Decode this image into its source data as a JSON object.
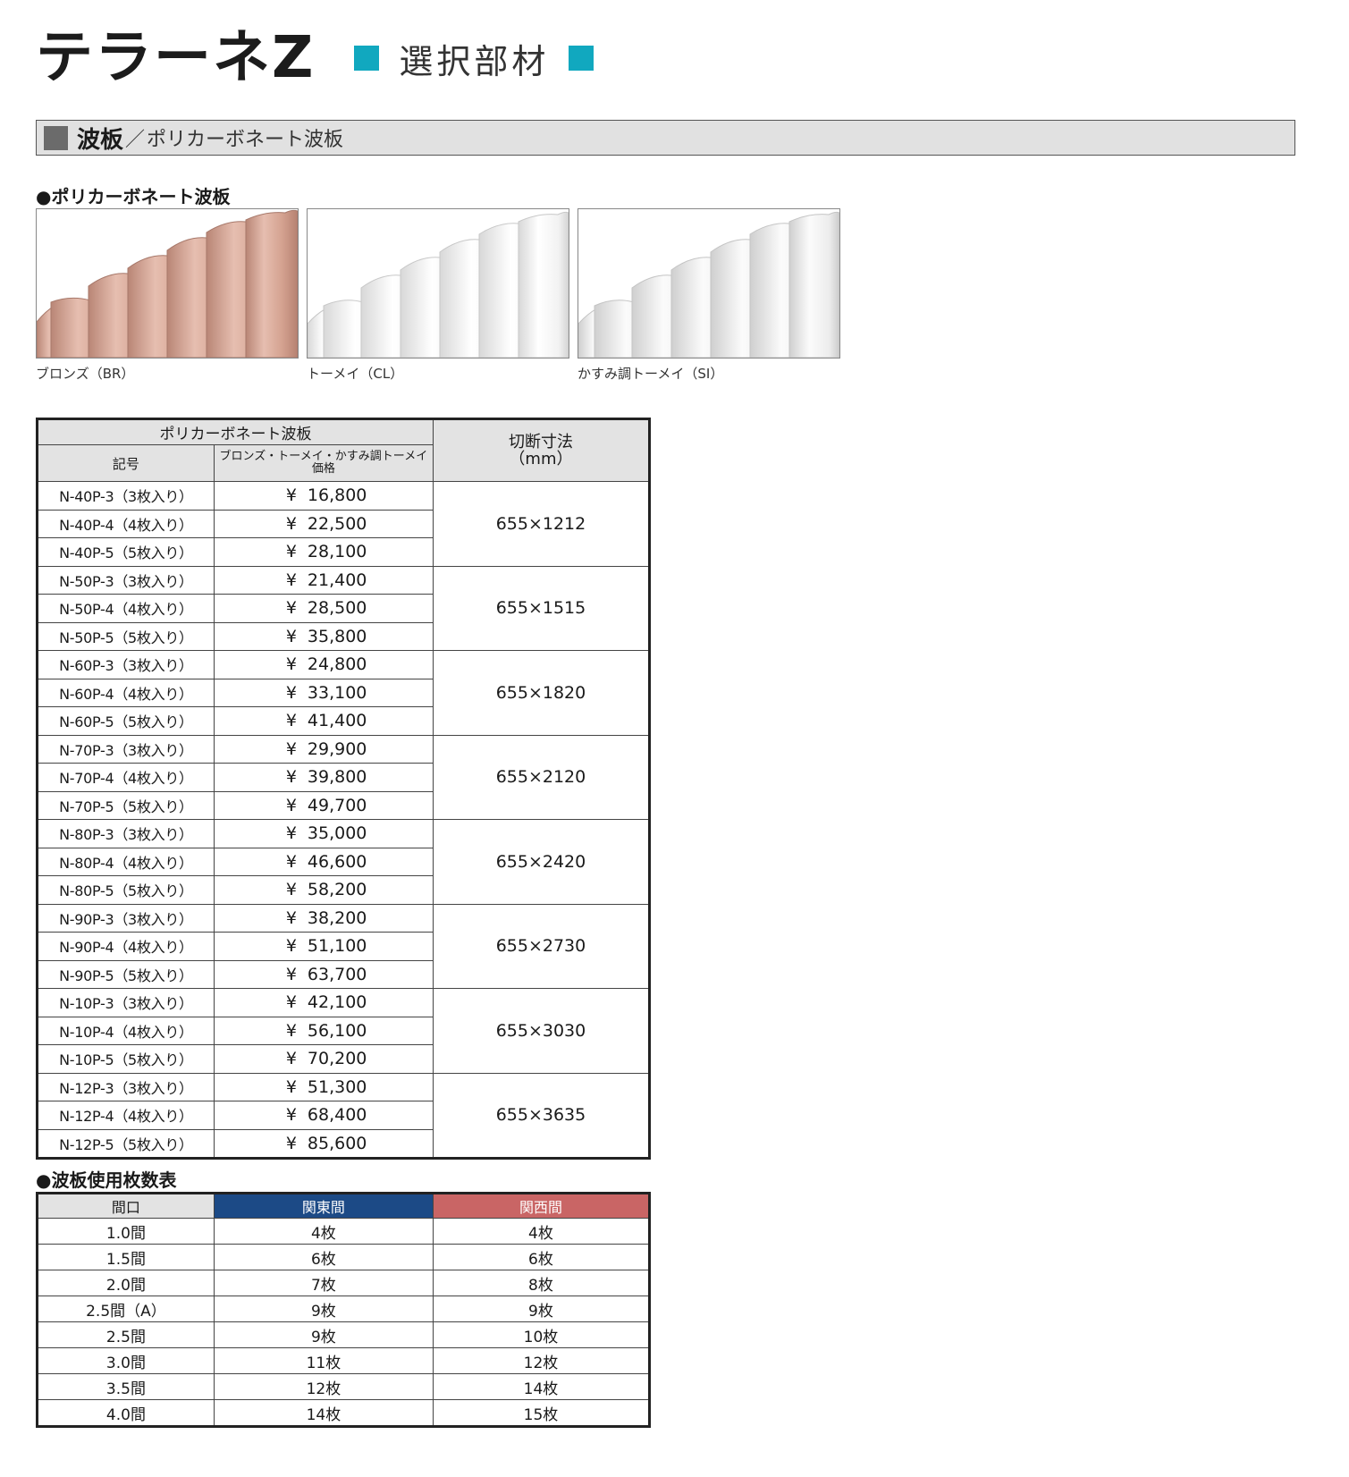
{
  "header": {
    "brand": "テラーネZ",
    "subtitle": "選択部材"
  },
  "section": {
    "main": "波板",
    "sep": "／",
    "sub": "ポリカーボネート波板"
  },
  "swatches": {
    "heading": "●ポリカーボネート波板",
    "items": [
      {
        "label": "ブロンズ（BR）",
        "color": "#d9a898"
      },
      {
        "label": "トーメイ（CL）",
        "color": "#ffffff"
      },
      {
        "label": "かすみ調トーメイ（SI）",
        "color": "#fafafa"
      }
    ]
  },
  "price_table": {
    "header_main": "ポリカーボネート波板",
    "header_code": "記号",
    "header_price_l1": "ブロンズ・トーメイ・かすみ調トーメイ",
    "header_price_l2": "価格",
    "header_cut_l1": "切断寸法",
    "header_cut_l2": "（mm）",
    "yen": "¥",
    "groups": [
      {
        "dim": "655×1212",
        "rows": [
          {
            "code": "N-40P-3（3枚入り）",
            "price": "16,800"
          },
          {
            "code": "N-40P-4（4枚入り）",
            "price": "22,500"
          },
          {
            "code": "N-40P-5（5枚入り）",
            "price": "28,100"
          }
        ]
      },
      {
        "dim": "655×1515",
        "rows": [
          {
            "code": "N-50P-3（3枚入り）",
            "price": "21,400"
          },
          {
            "code": "N-50P-4（4枚入り）",
            "price": "28,500"
          },
          {
            "code": "N-50P-5（5枚入り）",
            "price": "35,800"
          }
        ]
      },
      {
        "dim": "655×1820",
        "rows": [
          {
            "code": "N-60P-3（3枚入り）",
            "price": "24,800"
          },
          {
            "code": "N-60P-4（4枚入り）",
            "price": "33,100"
          },
          {
            "code": "N-60P-5（5枚入り）",
            "price": "41,400"
          }
        ]
      },
      {
        "dim": "655×2120",
        "rows": [
          {
            "code": "N-70P-3（3枚入り）",
            "price": "29,900"
          },
          {
            "code": "N-70P-4（4枚入り）",
            "price": "39,800"
          },
          {
            "code": "N-70P-5（5枚入り）",
            "price": "49,700"
          }
        ]
      },
      {
        "dim": "655×2420",
        "rows": [
          {
            "code": "N-80P-3（3枚入り）",
            "price": "35,000"
          },
          {
            "code": "N-80P-4（4枚入り）",
            "price": "46,600"
          },
          {
            "code": "N-80P-5（5枚入り）",
            "price": "58,200"
          }
        ]
      },
      {
        "dim": "655×2730",
        "rows": [
          {
            "code": "N-90P-3（3枚入り）",
            "price": "38,200"
          },
          {
            "code": "N-90P-4（4枚入り）",
            "price": "51,100"
          },
          {
            "code": "N-90P-5（5枚入り）",
            "price": "63,700"
          }
        ]
      },
      {
        "dim": "655×3030",
        "rows": [
          {
            "code": "N-10P-3（3枚入り）",
            "price": "42,100"
          },
          {
            "code": "N-10P-4（4枚入り）",
            "price": "56,100"
          },
          {
            "code": "N-10P-5（5枚入り）",
            "price": "70,200"
          }
        ]
      },
      {
        "dim": "655×3635",
        "rows": [
          {
            "code": "N-12P-3（3枚入り）",
            "price": "51,300"
          },
          {
            "code": "N-12P-4（4枚入り）",
            "price": "68,400"
          },
          {
            "code": "N-12P-5（5枚入り）",
            "price": "85,600"
          }
        ]
      }
    ]
  },
  "count_table": {
    "heading": "●波板使用枚数表",
    "headers": [
      "間口",
      "関東間",
      "関西間"
    ],
    "colors": {
      "kanto": "#1c4a86",
      "kansai": "#c96565"
    },
    "rows": [
      [
        "1.0間",
        "4枚",
        "4枚"
      ],
      [
        "1.5間",
        "6枚",
        "6枚"
      ],
      [
        "2.0間",
        "7枚",
        "8枚"
      ],
      [
        "2.5間（A）",
        "9枚",
        "9枚"
      ],
      [
        "2.5間",
        "9枚",
        "10枚"
      ],
      [
        "3.0間",
        "11枚",
        "12枚"
      ],
      [
        "3.5間",
        "12枚",
        "14枚"
      ],
      [
        "4.0間",
        "14枚",
        "15枚"
      ]
    ]
  }
}
